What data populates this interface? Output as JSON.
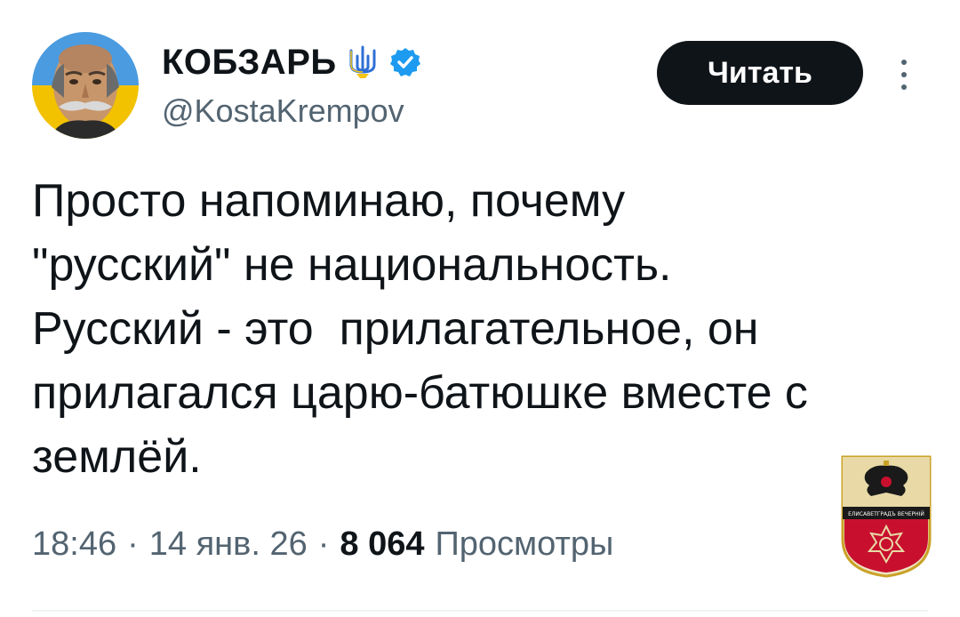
{
  "author": {
    "display_name": "КОБЗАРЬ",
    "handle": "@KostaKrempov",
    "icons": [
      "trident-icon",
      "verified-badge-icon"
    ],
    "verified_color": "#1d9bf0"
  },
  "follow_button": {
    "label": "Читать"
  },
  "tweet": {
    "text": "Просто напоминаю, почему\n\"русский\" не национальность.\nРусский - это  прилагательное, он\nприлагался царю-батюшке вместе с\nземлёй."
  },
  "meta": {
    "time": "18:46",
    "date": "14 янв. 26",
    "separator": "·",
    "views_count": "8 064",
    "views_label": "Просмотры"
  },
  "emblem": {
    "text": "ЕЛИСАВЕТГРАДЪ ВЕЧЕРНІЙ"
  },
  "colors": {
    "text_primary": "#0f1419",
    "text_secondary": "#536471",
    "button_bg": "#0f1419",
    "trident_blue": "#2f6fd6",
    "trident_yellow": "#f5c518",
    "emblem_red": "#c8102e",
    "emblem_gold": "#c9a227"
  }
}
